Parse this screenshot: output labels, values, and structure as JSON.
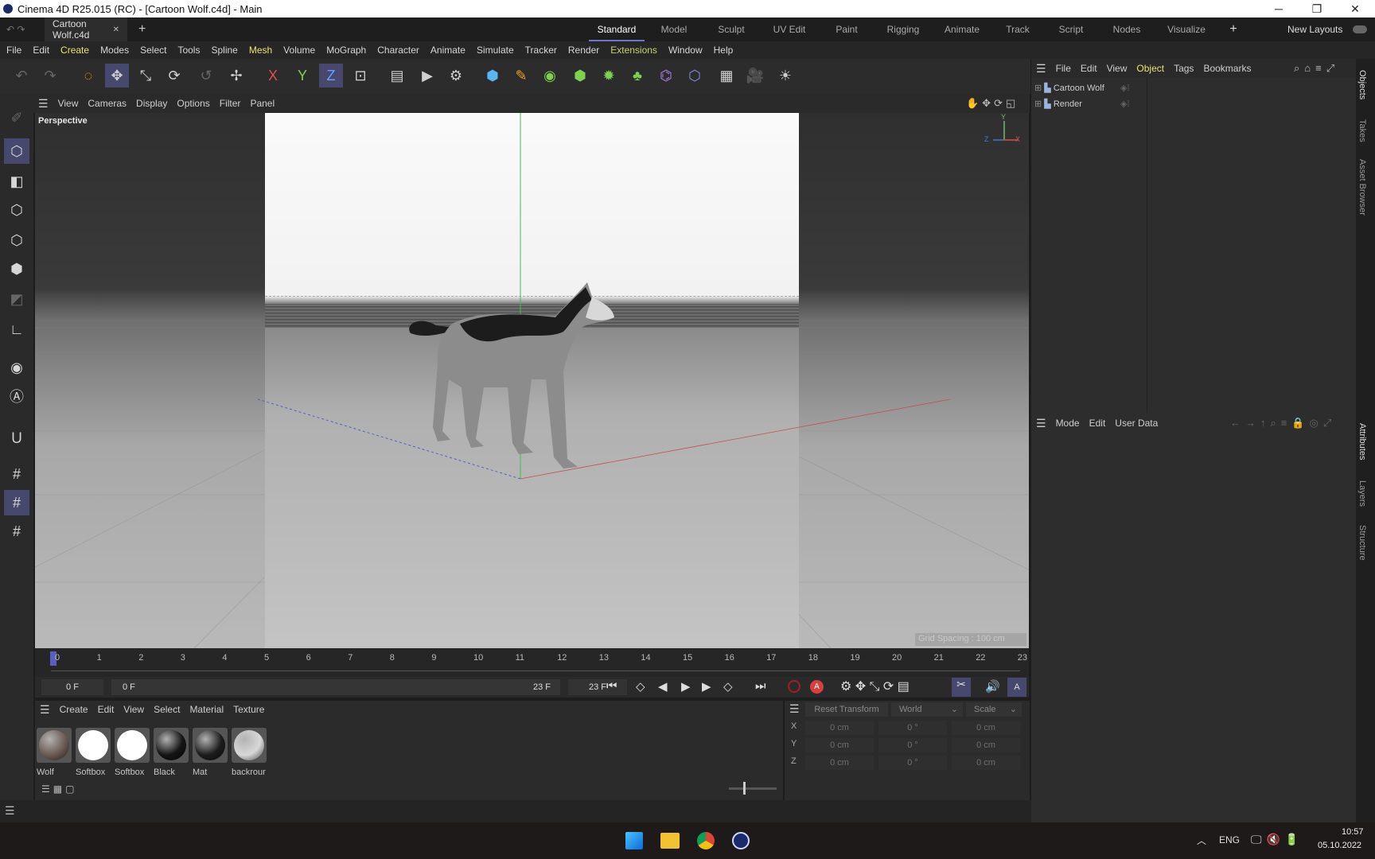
{
  "window": {
    "title": "Cinema 4D R25.015 (RC) - [Cartoon Wolf.c4d] - Main",
    "minimize": "─",
    "restore": "❐",
    "close": "✕"
  },
  "tabs": {
    "document": "Cartoon Wolf.c4d",
    "close": "✕",
    "add": "+",
    "layouts": [
      "Standard",
      "Model",
      "Sculpt",
      "UV Edit",
      "Paint",
      "Rigging",
      "Animate",
      "Track",
      "Script",
      "Nodes",
      "Visualize"
    ],
    "add_layout": "+",
    "new_layouts": "New Layouts"
  },
  "menu": [
    "File",
    "Edit",
    "Create",
    "Modes",
    "Select",
    "Tools",
    "Spline",
    "Mesh",
    "Volume",
    "MoGraph",
    "Character",
    "Animate",
    "Simulate",
    "Tracker",
    "Render",
    "Extensions",
    "Window",
    "Help"
  ],
  "toolbar": {
    "axis_x": "X",
    "axis_y": "Y",
    "axis_z": "Z"
  },
  "viewport": {
    "menu": [
      "View",
      "Cameras",
      "Display",
      "Options",
      "Filter",
      "Panel"
    ],
    "label": "Perspective",
    "grid_spacing": "Grid Spacing : 100 cm",
    "axis": {
      "x": "X",
      "y": "Y",
      "z": "Z"
    }
  },
  "timeline": {
    "frames": [
      "0",
      "1",
      "2",
      "3",
      "4",
      "5",
      "6",
      "7",
      "8",
      "9",
      "10",
      "11",
      "12",
      "13",
      "14",
      "15",
      "16",
      "17",
      "18",
      "19",
      "20",
      "21",
      "22",
      "23"
    ],
    "current_frame": "0 F",
    "range_start": "0 F",
    "range_end": "23 F",
    "end_frame": "23 F"
  },
  "materials": {
    "menu": [
      "Create",
      "Edit",
      "View",
      "Select",
      "Material",
      "Texture"
    ],
    "items": [
      {
        "name": "Wolf",
        "color": "#6a5a52"
      },
      {
        "name": "Softbox",
        "color": "#ffffff"
      },
      {
        "name": "Softbox",
        "color": "#ffffff"
      },
      {
        "name": "Black",
        "color": "#141414"
      },
      {
        "name": "Mat",
        "color": "#1c1c1c"
      },
      {
        "name": "backrour",
        "color": "#d8d8d8"
      }
    ]
  },
  "coordinates": {
    "reset": "Reset Transform",
    "space": "World",
    "mode": "Scale",
    "rows": [
      {
        "axis": "X",
        "p": "0 cm",
        "r": "0 °",
        "s": "0 cm"
      },
      {
        "axis": "Y",
        "p": "0 cm",
        "r": "0 °",
        "s": "0 cm"
      },
      {
        "axis": "Z",
        "p": "0 cm",
        "r": "0 °",
        "s": "0 cm"
      }
    ]
  },
  "objects": {
    "menu": [
      "File",
      "Edit",
      "View",
      "Object",
      "Tags",
      "Bookmarks"
    ],
    "items": [
      "Cartoon Wolf",
      "Render"
    ]
  },
  "attributes": {
    "menu": [
      "Mode",
      "Edit",
      "User Data"
    ]
  },
  "side_tabs": [
    "Objects",
    "Takes",
    "Asset Browser",
    "Attributes",
    "Layers",
    "Structure"
  ],
  "taskbar": {
    "language": "ENG",
    "time": "10:57",
    "date": "05.10.2022"
  },
  "colors": {
    "accent": "#46486e",
    "active_menu": "#e8e46e",
    "extensions": "#c8d26a"
  }
}
